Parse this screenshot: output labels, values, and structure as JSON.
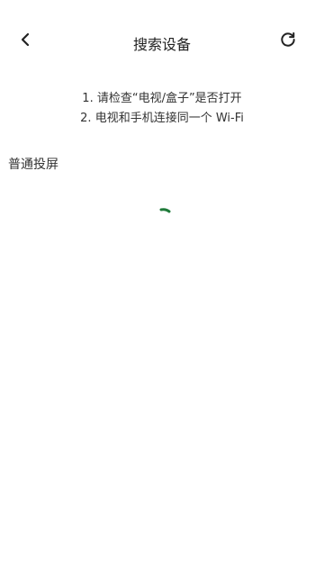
{
  "header": {
    "title": "搜索设备",
    "back_icon": "chevron-left-icon",
    "refresh_icon": "refresh-icon"
  },
  "tips": {
    "line1": "1. 请检查“电视/盒子”是否打开",
    "line2": "2. 电视和手机连接同一个 Wi-Fi"
  },
  "section": {
    "label": "普通投屏"
  },
  "colors": {
    "spinner": "#1f7a3a"
  }
}
